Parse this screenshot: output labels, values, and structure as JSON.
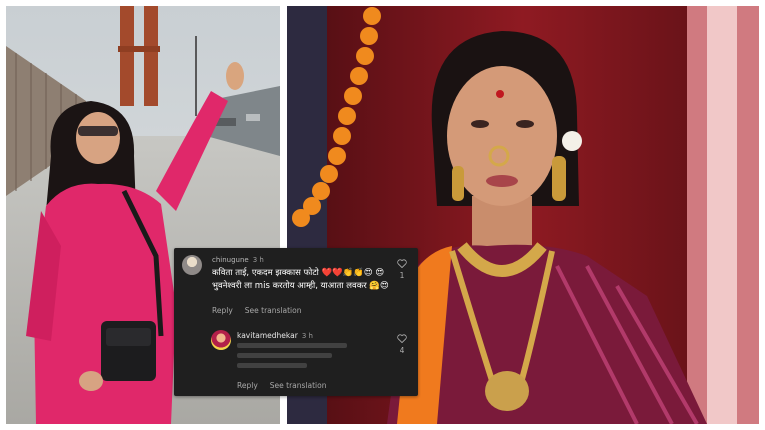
{
  "comment_card": {
    "comment1": {
      "username": "chinugune",
      "time": "3 h",
      "text": "कविता ताई, एकदम झक्कास फोटो ❤️❤️👏👏😍 😍 भुवनेश्वरी ला mis करतोय आम्ही, याआता लवकर 🤗😍",
      "like_count": "1",
      "reply_label": "Reply",
      "translation_label": "See translation"
    },
    "comment2": {
      "username": "kavitamedhekar",
      "time": "3 h",
      "like_count": "4",
      "reply_label": "Reply",
      "translation_label": "See translation"
    }
  },
  "colors": {
    "card_bg": "#1f1f1f",
    "outfit_pink": "#e02a6a",
    "saree_maroon": "#7a1a3a",
    "saree_orange": "#f07a1e"
  },
  "icons": [
    "heart-outline-icon"
  ]
}
